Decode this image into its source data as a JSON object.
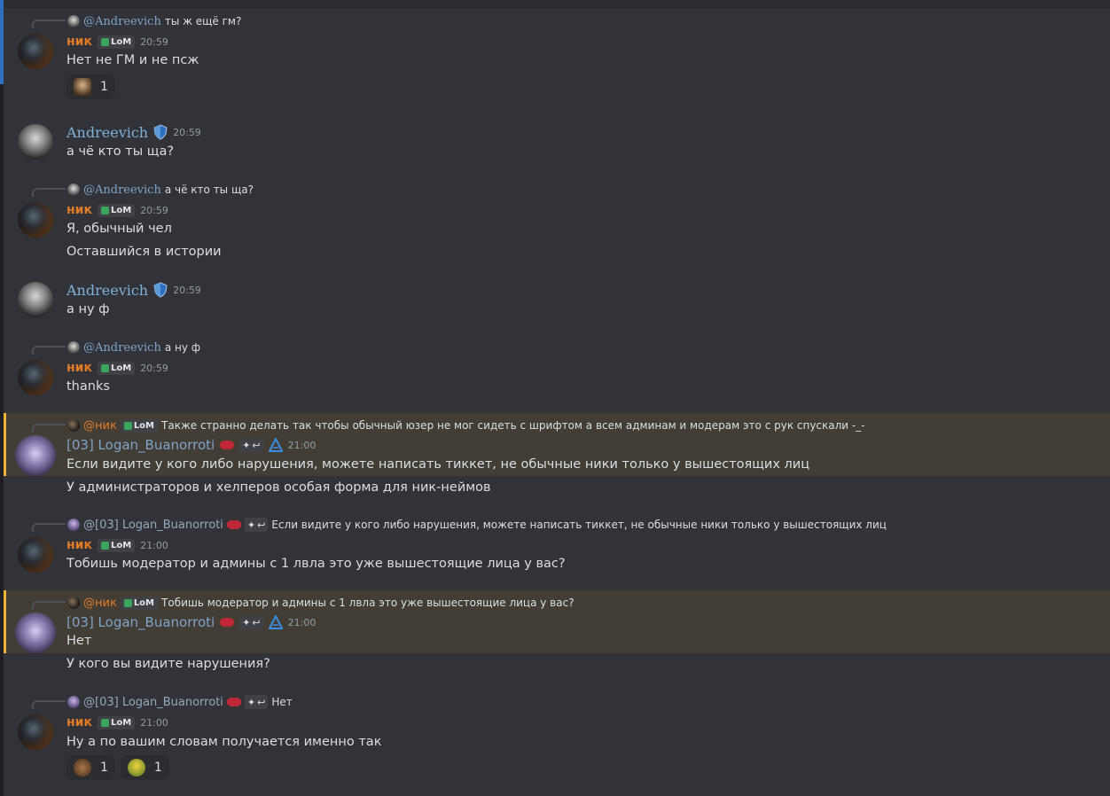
{
  "colors": {
    "background": "#313338",
    "highlight": "#423e36",
    "mention_bar": "#f0b232",
    "nik_name": "#e07b28",
    "andr_name": "#7fb0d8"
  },
  "tag_label": "LoM",
  "messages": [
    {
      "reply": {
        "name": "@Andreevich",
        "text": "ты ж ещё гм?"
      },
      "author": "ник",
      "time": "20:59",
      "lines": [
        "Нет не ГМ и не псж"
      ],
      "reactions": [
        {
          "icon": "person-emoji",
          "count": "1"
        }
      ]
    },
    {
      "author": "Andreevich",
      "time": "20:59",
      "lines": [
        "а чё кто ты ща?"
      ]
    },
    {
      "reply": {
        "name": "@Andreevich",
        "text": "а чё кто ты ща?"
      },
      "author": "ник",
      "time": "20:59",
      "lines": [
        "Я, обычный чел",
        "Оставшийся в истории"
      ]
    },
    {
      "author": "Andreevich",
      "time": "20:59",
      "lines": [
        "а ну ф"
      ]
    },
    {
      "reply": {
        "name": "@Andreevich",
        "text": "а ну ф"
      },
      "author": "ник",
      "time": "20:59",
      "lines": [
        "thanks"
      ]
    },
    {
      "reply": {
        "name": "@ник",
        "tag": "LoM",
        "text": "Также странно делать так чтобы обычный юзер не мог сидеть с шрифтом а всем админам и модерам это с рук спускали -_-"
      },
      "author": "[03] Logan_Buanorroti",
      "time": "21:00",
      "lines": [
        "Если видите у кого либо нарушения, можете написать тиккет, не обычные ники только у вышестоящих лиц",
        "У администраторов и хелперов особая форма для ник-неймов"
      ]
    },
    {
      "reply": {
        "name": "@[03] Logan_Buanorroti",
        "text": "Если видите у кого либо нарушения, можете написать тиккет, не обычные ники только у вышестоящих лиц"
      },
      "author": "ник",
      "time": "21:00",
      "lines": [
        "Тобишь модератор и админы с 1 лвла это уже вышестоящие лица у вас?"
      ]
    },
    {
      "reply": {
        "name": "@ник",
        "tag": "LoM",
        "text": "Тобишь модератор и админы с 1 лвла это уже вышестоящие лица у вас?"
      },
      "author": "[03] Logan_Buanorroti",
      "time": "21:00",
      "lines": [
        "Нет",
        "У кого вы видите нарушения?"
      ]
    },
    {
      "reply": {
        "name": "@[03] Logan_Buanorroti",
        "text": "Нет"
      },
      "author": "ник",
      "time": "21:00",
      "lines": [
        "Ну а по вашим словам получается именно так"
      ],
      "reactions": [
        {
          "icon": "bear-emoji",
          "count": "1"
        },
        {
          "icon": "flower-emoji",
          "count": "1"
        }
      ]
    }
  ]
}
